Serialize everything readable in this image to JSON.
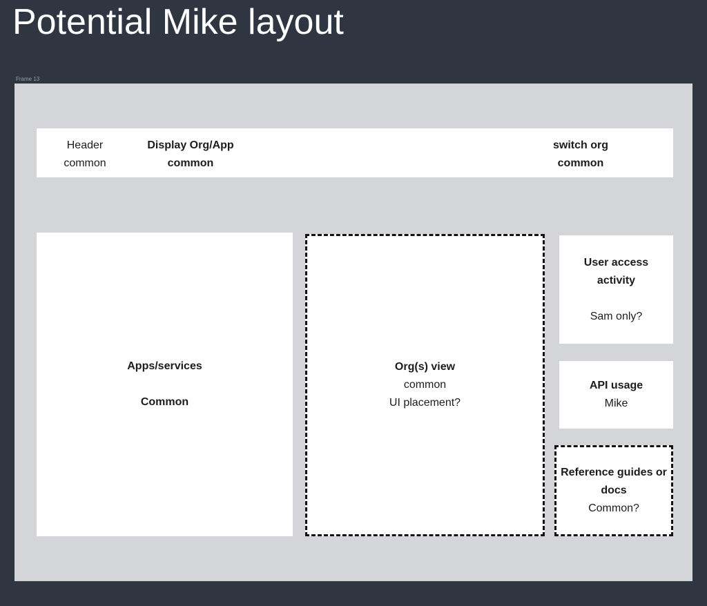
{
  "title": "Potential Mike layout",
  "frame_label": "Frame 13",
  "header_bar": {
    "header_label": "Header",
    "header_sub": "common",
    "display_org": "Display Org/App",
    "display_org_sub": "common",
    "switch_org": "switch org",
    "switch_org_sub": "common"
  },
  "apps_services": {
    "title": "Apps/services",
    "sub": "Common"
  },
  "orgs_view": {
    "title": "Org(s) view",
    "sub": "common",
    "note": "UI placement?"
  },
  "user_access": {
    "title_line1": "User access",
    "title_line2": "activity",
    "note": "Sam only?"
  },
  "api_usage": {
    "title": "API usage",
    "sub": "Mike"
  },
  "reference": {
    "title_line1": "Reference guides or",
    "title_line2": "docs",
    "note": "Common?"
  }
}
